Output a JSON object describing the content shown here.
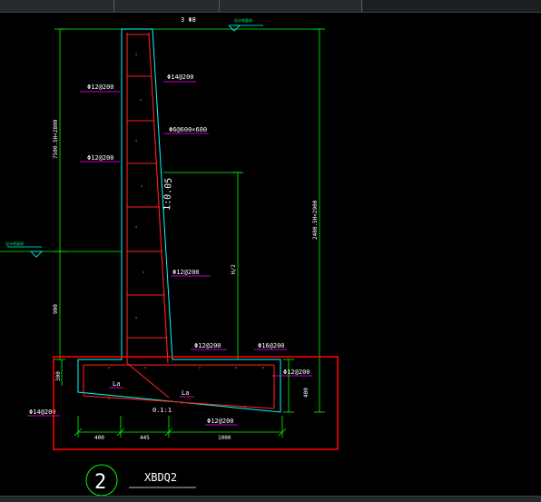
{
  "colors": {
    "background": "#000000",
    "wall_outline": "#00ffff",
    "rebar": "#ff2020",
    "dimension": "#00ff00",
    "text": "#ffffff",
    "leader": "#ff00ff",
    "selection_box": "#ff0000"
  },
  "annotations": {
    "top_bar": "3 Φ8",
    "top_grade": "Φ14@200",
    "left_vert_1": "Φ12@200",
    "left_vert_2": "Φ12@200",
    "mid_ties": "Φ6@600×600",
    "slope": "1:0.05",
    "back_face": "Φ12@200",
    "heel_top_1": "Φ12@200",
    "heel_top_2": "Φ16@200",
    "heel_right": "Φ12@200",
    "footing_left": "Φ14@200",
    "footing_bottom": "Φ12@200",
    "la_1": "La",
    "la_2": "La",
    "slope_small": "0.1:1"
  },
  "dimensions": {
    "left_upper": "7500.5H<2800",
    "left_lower": "900",
    "right_total": "2400.5H<2900",
    "right_h2": "H/2",
    "footing_left_h": "300",
    "footing_right_h": "400",
    "bottom_1": "400",
    "bottom_2": "445",
    "bottom_3": "1000"
  },
  "grade_labels": {
    "top_right": "设计地面线",
    "left": "设计地面线"
  },
  "section": {
    "number": "2",
    "name": "XBDQ2"
  }
}
